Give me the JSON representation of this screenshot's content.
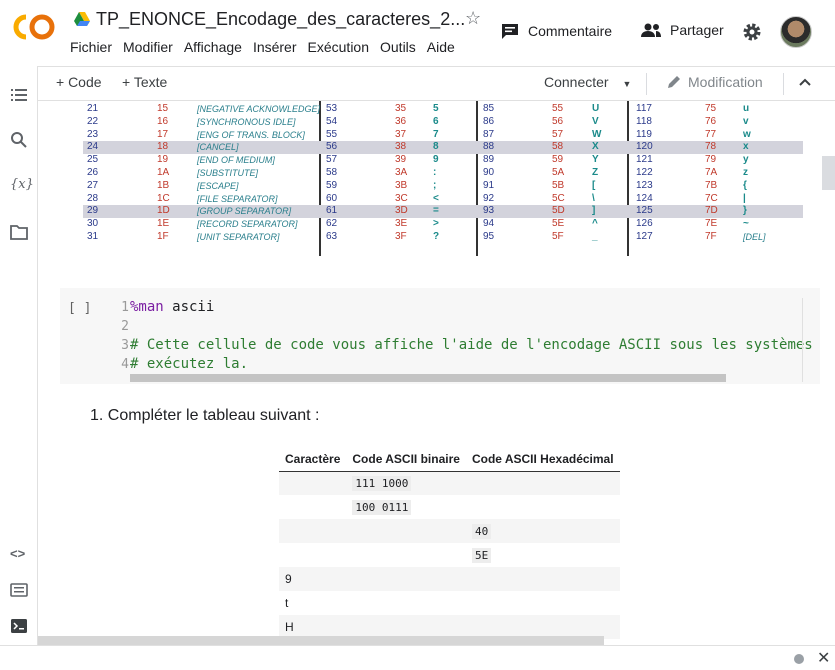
{
  "header": {
    "title": "TP_ENONCE_Encodage_des_caracteres_2...",
    "menu": [
      "Fichier",
      "Modifier",
      "Affichage",
      "Insérer",
      "Exécution",
      "Outils",
      "Aide"
    ],
    "comment_label": "Commentaire",
    "share_label": "Partager"
  },
  "toolbar": {
    "add_code": "+ Code",
    "add_text": "+ Texte",
    "connect": "Connecter",
    "mode": "Modification"
  },
  "ascii_rows": [
    {
      "d1": "21",
      "h1": "15",
      "desc": "[NEGATIVE ACKNOWLEDGE]",
      "d2": "53",
      "h2": "35",
      "c2": "5",
      "d3": "85",
      "h3": "55",
      "c3": "U",
      "d4": "117",
      "h4": "75",
      "c4": "u",
      "hl": false
    },
    {
      "d1": "22",
      "h1": "16",
      "desc": "[SYNCHRONOUS IDLE]",
      "d2": "54",
      "h2": "36",
      "c2": "6",
      "d3": "86",
      "h3": "56",
      "c3": "V",
      "d4": "118",
      "h4": "76",
      "c4": "v",
      "hl": false
    },
    {
      "d1": "23",
      "h1": "17",
      "desc": "[ENG OF TRANS. BLOCK]",
      "d2": "55",
      "h2": "37",
      "c2": "7",
      "d3": "87",
      "h3": "57",
      "c3": "W",
      "d4": "119",
      "h4": "77",
      "c4": "w",
      "hl": false
    },
    {
      "d1": "24",
      "h1": "18",
      "desc": "[CANCEL]",
      "d2": "56",
      "h2": "38",
      "c2": "8",
      "d3": "88",
      "h3": "58",
      "c3": "X",
      "d4": "120",
      "h4": "78",
      "c4": "x",
      "hl": true
    },
    {
      "d1": "25",
      "h1": "19",
      "desc": "[END OF MEDIUM]",
      "d2": "57",
      "h2": "39",
      "c2": "9",
      "d3": "89",
      "h3": "59",
      "c3": "Y",
      "d4": "121",
      "h4": "79",
      "c4": "y",
      "hl": false
    },
    {
      "d1": "26",
      "h1": "1A",
      "desc": "[SUBSTITUTE]",
      "d2": "58",
      "h2": "3A",
      "c2": ":",
      "d3": "90",
      "h3": "5A",
      "c3": "Z",
      "d4": "122",
      "h4": "7A",
      "c4": "z",
      "hl": false
    },
    {
      "d1": "27",
      "h1": "1B",
      "desc": "[ESCAPE]",
      "d2": "59",
      "h2": "3B",
      "c2": ";",
      "d3": "91",
      "h3": "5B",
      "c3": "[",
      "d4": "123",
      "h4": "7B",
      "c4": "{",
      "hl": false
    },
    {
      "d1": "28",
      "h1": "1C",
      "desc": "[FILE SEPARATOR]",
      "d2": "60",
      "h2": "3C",
      "c2": "<",
      "d3": "92",
      "h3": "5C",
      "c3": "\\",
      "d4": "124",
      "h4": "7C",
      "c4": "|",
      "hl": false
    },
    {
      "d1": "29",
      "h1": "1D",
      "desc": "[GROUP SEPARATOR]",
      "d2": "61",
      "h2": "3D",
      "c2": "=",
      "d3": "93",
      "h3": "5D",
      "c3": "]",
      "d4": "125",
      "h4": "7D",
      "c4": "}",
      "hl": true
    },
    {
      "d1": "30",
      "h1": "1E",
      "desc": "[RECORD SEPARATOR]",
      "d2": "62",
      "h2": "3E",
      "c2": ">",
      "d3": "94",
      "h3": "5E",
      "c3": "^",
      "d4": "126",
      "h4": "7E",
      "c4": "~",
      "hl": false
    },
    {
      "d1": "31",
      "h1": "1F",
      "desc": "[UNIT SEPARATOR]",
      "d2": "63",
      "h2": "3F",
      "c2": "?",
      "d3": "95",
      "h3": "5F",
      "c3": "_",
      "d4": "127",
      "h4": "7F",
      "c4": "[DEL]",
      "hl": false
    }
  ],
  "code_cell": {
    "run_label": "[ ]",
    "lines": [
      {
        "n": "1",
        "magic": "%man",
        "rest": " ascii",
        "comment": ""
      },
      {
        "n": "2",
        "magic": "",
        "rest": "",
        "comment": ""
      },
      {
        "n": "3",
        "magic": "",
        "rest": "",
        "comment": "# Cette cellule de code vous affiche l'aide de l'encodage ASCII sous les systèmes"
      },
      {
        "n": "4",
        "magic": "",
        "rest": "",
        "comment": "# exécutez la."
      }
    ]
  },
  "text_cell": {
    "item": "1. Compléter le tableau suivant :"
  },
  "table": {
    "headers": [
      "Caractère",
      "Code ASCII binaire",
      "Code ASCII Hexadécimal"
    ],
    "rows": [
      [
        "",
        "111 1000",
        ""
      ],
      [
        "",
        "100 0111",
        ""
      ],
      [
        "",
        "",
        "40"
      ],
      [
        "",
        "",
        "5E"
      ],
      [
        "9",
        "",
        ""
      ],
      [
        "t",
        "",
        ""
      ],
      [
        "H",
        "",
        ""
      ]
    ]
  }
}
